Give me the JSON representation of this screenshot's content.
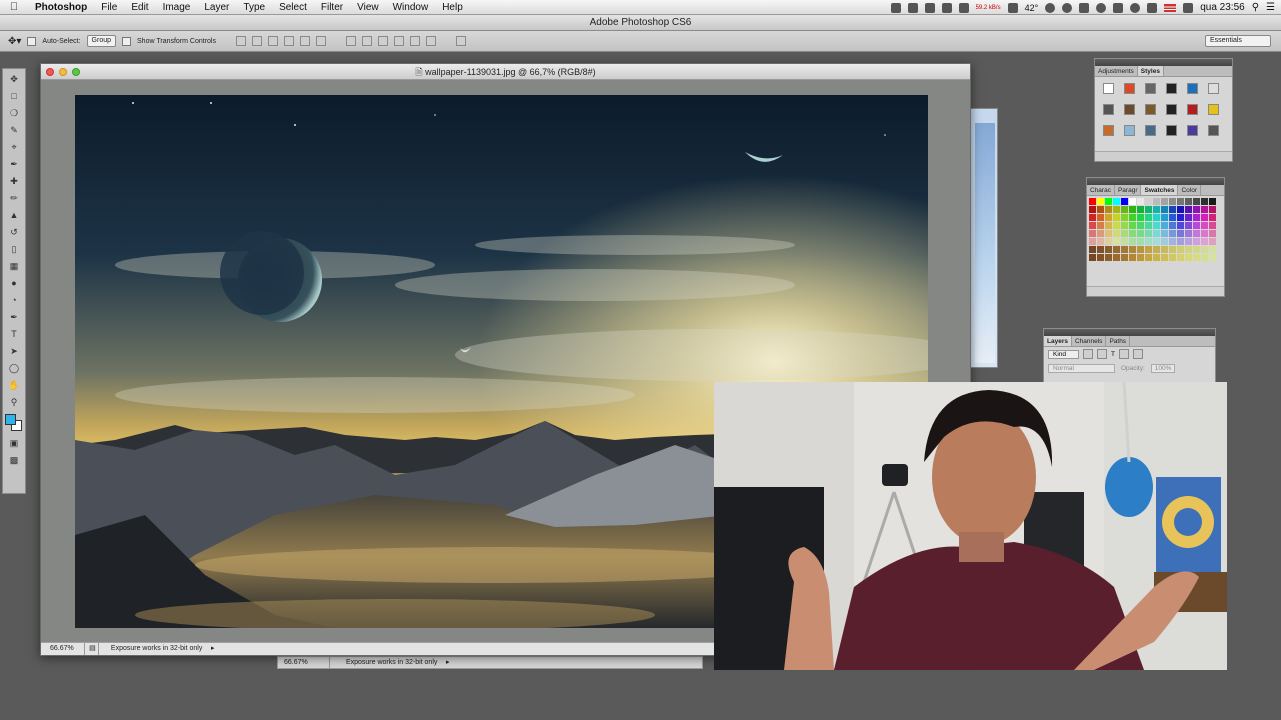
{
  "menubar": {
    "apple": "",
    "app": "Photoshop",
    "items": [
      "File",
      "Edit",
      "Image",
      "Layer",
      "Type",
      "Select",
      "Filter",
      "View",
      "Window",
      "Help"
    ],
    "status": {
      "network": "59.2 kB/s",
      "temp": "42°",
      "clock": "qua 23:56"
    }
  },
  "ps_title": "Adobe Photoshop CS6",
  "options": {
    "auto_select": "Auto-Select:",
    "group": "Group",
    "show_transform": "Show Transform Controls",
    "workspace": "Essentials"
  },
  "document": {
    "title": "wallpaper-1139031.jpg @ 66,7% (RGB/8#)",
    "zoom": "66.67%",
    "status": "Exposure works in 32-bit only"
  },
  "document2": {
    "zoom": "66.67%",
    "status": "Exposure works in 32-bit only"
  },
  "panels": {
    "adjustments_tabs": [
      "Adjustments",
      "Styles"
    ],
    "swatches_tabs": [
      "Charac",
      "Paragr",
      "Swatches",
      "Color"
    ],
    "layers_tabs": [
      "Layers",
      "Channels",
      "Paths"
    ],
    "layers_kind": "Kind",
    "blend_mode": "Normal",
    "opacity_label": "Opacity:",
    "opacity_value": "100%"
  },
  "colors": {
    "foreground": "#2fb4ea",
    "background": "#ffffff",
    "app_bg": "#5a5a5a"
  }
}
